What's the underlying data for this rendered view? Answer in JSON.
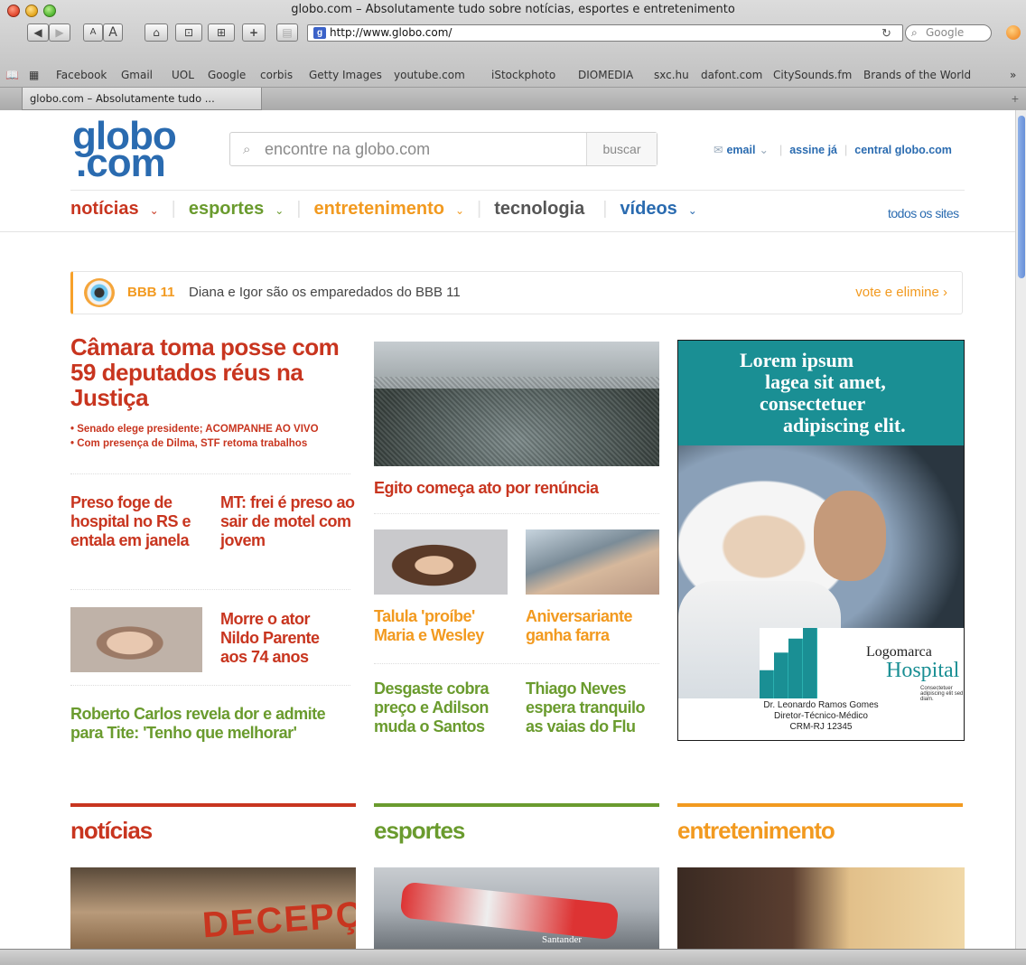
{
  "browser": {
    "window_title": "globo.com – Absolutamente tudo sobre notícias, esportes e entretenimento",
    "url": "http://www.globo.com/",
    "search_placeholder": "Google",
    "tab_title": "globo.com – Absolutamente tudo ...",
    "buttons": {
      "back": "◀",
      "forward": "▶",
      "text_smaller": "A",
      "text_bigger": "A",
      "home": "⌂",
      "history": "⊡",
      "bookmarks": "⊞",
      "add": "+",
      "print": "▤"
    },
    "bookmarks": [
      "Facebook",
      "Gmail",
      "UOL",
      "Google",
      "corbis",
      "Getty Images",
      "youtube.com",
      "iStockphoto",
      "DIOMEDIA",
      "sxc.hu",
      "dafont.com",
      "CitySounds.fm",
      "Brands of the World"
    ],
    "bookmarks_overflow": "»"
  },
  "header": {
    "logo_top": "globo",
    "logo_bottom": ".com",
    "search_placeholder": "encontre na globo.com",
    "search_button": "buscar",
    "links": {
      "email": "email",
      "assine": "assine já",
      "central": "central globo.com"
    },
    "nav": [
      "notícias",
      "esportes",
      "entretenimento",
      "tecnologia",
      "vídeos"
    ],
    "all_sites": "todos os sites"
  },
  "bbb": {
    "tag": "BBB 11",
    "text": "Diana e Igor são os emparedados do BBB 11",
    "vote": "vote e elimine ›"
  },
  "news": {
    "main_headline": "Câmara toma posse com 59 deputados réus na Justiça",
    "bullets": [
      "• Senado elege presidente; ACOMPANHE AO VIVO",
      "• Com presença de Dilma, STF retoma trabalhos"
    ],
    "h_preso": "Preso foge de hospital no RS e entala em janela",
    "h_frei": "MT: frei é preso ao sair de motel com jovem",
    "h_ator": "Morre o ator Nildo Parente aos 74 anos",
    "h_roberto": "Roberto Carlos revela dor e admite para Tite: 'Tenho que melhorar'",
    "h_egito": "Egito começa ato por renúncia",
    "h_talula": "Talula 'proíbe' Maria e Wesley",
    "h_aniv": "Aniversariante ganha farra",
    "h_desgaste": "Desgaste cobra preço e Adilson muda o Santos",
    "h_thiago": "Thiago Neves espera tranquilo as vaias do Flu"
  },
  "ad": {
    "lines": [
      "Lorem ipsum",
      "lagea sit amet,",
      "consectetuer",
      "adipiscing elit."
    ],
    "logomarca": "Logomarca",
    "hospital": "Hospital",
    "tagline": "Consectetuer adipiscing elit sed diam.",
    "sig_name": "Dr. Leonardo Ramos Gomes",
    "sig_role": "Diretor-Técnico-Médico",
    "sig_crm": "CRM-RJ 12345"
  },
  "sections": {
    "noticias": "notícias",
    "esportes": "esportes",
    "entretenimento": "entretenimento",
    "protest_sign": "DECEPÇÃO",
    "car_sponsor": "Santander"
  },
  "colors": {
    "noticias": "#c8351f",
    "esportes": "#6a9b2e",
    "entretenimento": "#f29a20",
    "globo_blue": "#2a6bb0"
  }
}
